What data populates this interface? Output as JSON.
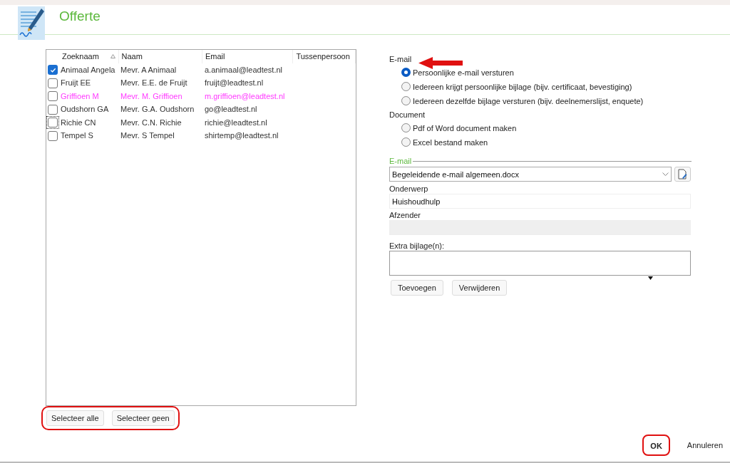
{
  "header": {
    "title": "Offerte"
  },
  "table": {
    "columns": [
      {
        "label": "Zoeknaam",
        "sorted": true
      },
      {
        "label": "Naam",
        "sorted": false
      },
      {
        "label": "Email",
        "sorted": false
      },
      {
        "label": "Tussenpersoon",
        "sorted": false
      }
    ],
    "rows": [
      {
        "checked": true,
        "focused": false,
        "color": "#333333",
        "cells": [
          "Animaal Angela",
          "Mevr. A Animaal",
          "a.animaal@leadtest.nl"
        ]
      },
      {
        "checked": false,
        "focused": false,
        "color": "#333333",
        "cells": [
          "Fruijt EE",
          "Mevr. E.E. de Fruijt",
          "fruijt@leadtest.nl"
        ]
      },
      {
        "checked": false,
        "focused": false,
        "color": "#ff3bff",
        "cells": [
          "Griffioen M",
          "Mevr. M. Griffioen",
          "m.griffioen@leadtest.nl"
        ]
      },
      {
        "checked": false,
        "focused": false,
        "color": "#333333",
        "cells": [
          "Oudshorn GA",
          "Mevr. G.A. Oudshorn",
          "go@leadtest.nl"
        ]
      },
      {
        "checked": false,
        "focused": true,
        "color": "#333333",
        "cells": [
          "Richie CN",
          "Mevr. C.N. Richie",
          "richie@leadtest.nl"
        ]
      },
      {
        "checked": false,
        "focused": false,
        "color": "#333333",
        "cells": [
          "Tempel S",
          "Mevr. S Tempel",
          "shirtemp@leadtest.nl"
        ]
      }
    ]
  },
  "list_buttons": [
    "Selecteer alle",
    "Selecteer geen"
  ],
  "options": [
    {
      "heading": "E-mail",
      "radios": [
        {
          "label": "Persoonlijke e-mail versturen",
          "selected": true
        },
        {
          "label": "Iedereen krijgt persoonlijke bijlage (bijv. certificaat, bevestiging)",
          "selected": false
        },
        {
          "label": "Iedereen dezelfde bijlage versturen (bijv. deelnemerslijst, enquete)",
          "selected": false
        }
      ]
    },
    {
      "heading": "Document",
      "radios": [
        {
          "label": "Pdf of Word document maken",
          "selected": false
        },
        {
          "label": "Excel bestand maken",
          "selected": false
        }
      ]
    }
  ],
  "email_group": {
    "title": "E-mail",
    "template": "Begeleidende e-mail algemeen.docx",
    "subject_label": "Onderwerp",
    "subject": "Huishoudhulp",
    "sender_label": "Afzender",
    "attachments_label": "Extra bijlage(n):",
    "buttons": [
      "Toevoegen",
      "Verwijderen"
    ]
  },
  "footer": {
    "ok": "OK",
    "cancel": "Annuleren"
  }
}
